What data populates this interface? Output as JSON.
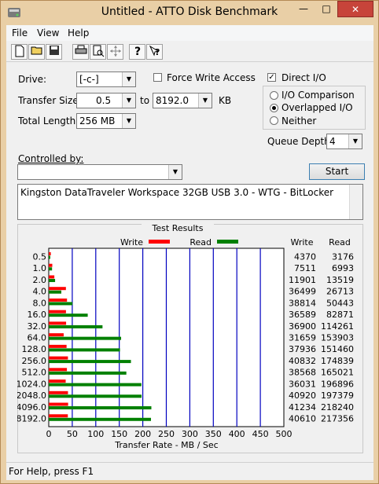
{
  "window": {
    "title": "Untitled - ATTO Disk Benchmark",
    "close": "✕",
    "maximize": "□",
    "minimize": "—"
  },
  "menu": [
    "File",
    "View",
    "Help"
  ],
  "toolbar_icons": [
    "new-document-icon",
    "open-folder-icon",
    "save-icon",
    "print-icon",
    "print-preview-icon",
    "move-icon",
    "help-icon",
    "context-help-icon"
  ],
  "form": {
    "drive_label": "Drive:",
    "drive_value": "[-c-]",
    "force_write_access": "Force Write Access",
    "force_write_checked": false,
    "direct_io": "Direct I/O",
    "direct_io_checked": true,
    "transfer_size_label": "Transfer Size:",
    "transfer_from": "0.5",
    "to_label": "to",
    "transfer_to": "8192.0",
    "kb_label": "KB",
    "total_length_label": "Total Length:",
    "total_length_value": "256 MB",
    "io_comparison": "I/O Comparison",
    "overlapped_io": "Overlapped I/O",
    "neither": "Neither",
    "selected_mode": "Overlapped I/O",
    "queue_depth_label": "Queue Depth:",
    "queue_depth_value": "4",
    "controlled_by_label": "Controlled by:",
    "controlled_by_value": "",
    "start_button": "Start",
    "description": "Kingston DataTraveler Workspace 32GB USB 3.0 - WTG - BitLocker"
  },
  "results": {
    "group_title": "Test Results",
    "write_header": "Write",
    "read_header": "Read",
    "legend_write": "Write",
    "legend_read": "Read"
  },
  "status": {
    "text": "For Help, press F1"
  },
  "chart_data": {
    "type": "bar",
    "orientation": "horizontal",
    "xlabel": "Transfer Rate - MB / Sec",
    "xlim": [
      0,
      500
    ],
    "xticks": [
      "0",
      "50",
      "100",
      "150",
      "200",
      "250",
      "300",
      "350",
      "400",
      "450",
      "500"
    ],
    "categories": [
      "0.5",
      "1.0",
      "2.0",
      "4.0",
      "8.0",
      "16.0",
      "32.0",
      "64.0",
      "128.0",
      "256.0",
      "512.0",
      "1024.0",
      "2048.0",
      "4096.0",
      "8192.0"
    ],
    "series": [
      {
        "name": "Write",
        "color": "#ff0000",
        "values": [
          4.37,
          7.51,
          11.9,
          36.5,
          38.8,
          36.6,
          36.9,
          31.7,
          37.9,
          40.8,
          38.6,
          36.0,
          40.9,
          41.2,
          40.6
        ],
        "labels": [
          "4370",
          "7511",
          "11901",
          "36499",
          "38814",
          "36589",
          "36900",
          "31659",
          "37936",
          "40832",
          "38568",
          "36031",
          "40920",
          "41234",
          "40610"
        ]
      },
      {
        "name": "Read",
        "color": "#008000",
        "values": [
          3.18,
          6.99,
          13.5,
          26.7,
          50.4,
          82.9,
          114.3,
          153.9,
          151.5,
          174.8,
          165.0,
          197.0,
          197.4,
          218.2,
          217.4
        ],
        "labels": [
          "3176",
          "6993",
          "13519",
          "26713",
          "50443",
          "82871",
          "114261",
          "153903",
          "151460",
          "174839",
          "165021",
          "196896",
          "197379",
          "218240",
          "217356"
        ]
      }
    ],
    "grid": true,
    "legend": "top"
  }
}
